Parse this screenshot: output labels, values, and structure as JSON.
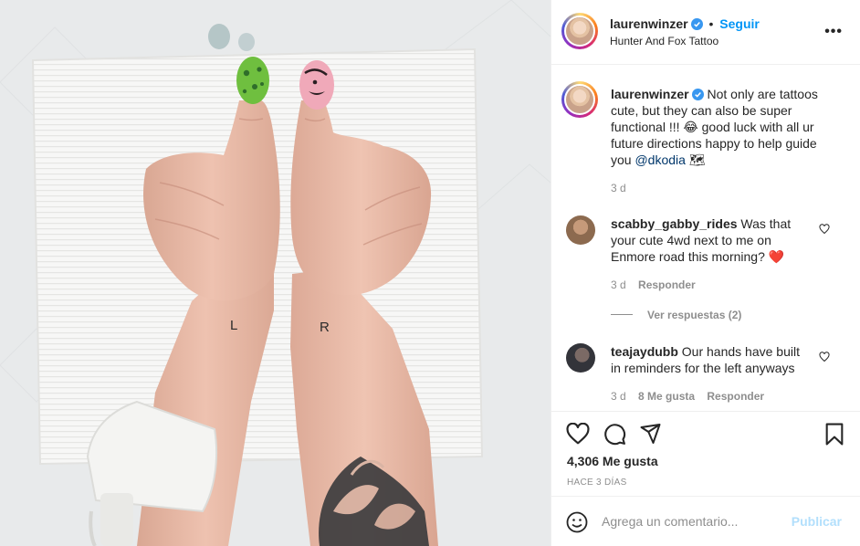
{
  "header": {
    "username": "laurenwinzer",
    "separator": "•",
    "follow_label": "Seguir",
    "location": "Hunter And Fox Tattoo",
    "more_icon": "more-horizontal-icon"
  },
  "caption": {
    "username": "laurenwinzer",
    "text_part1": "Not only are tattoos cute, but they can also be super functional !!! 😂 good luck with all ur future directions happy to help guide you ",
    "mention": "@dkodia",
    "text_part2": " 🗺",
    "time": "3 d"
  },
  "comments": [
    {
      "username": "scabby_gabby_rides",
      "text": "Was that your cute 4wd next to me on Enmore road this morning? ❤️",
      "time": "3 d",
      "reply_label": "Responder",
      "view_replies": "Ver respuestas (2)"
    },
    {
      "username": "teajaydubb",
      "text": "Our hands have built in reminders for the left anyways",
      "time": "3 d",
      "likes": "8 Me gusta",
      "reply_label": "Responder"
    }
  ],
  "actions": {
    "like_icon": "heart-icon",
    "comment_icon": "comment-icon",
    "share_icon": "share-icon",
    "save_icon": "bookmark-icon",
    "likes_text": "4,306 Me gusta",
    "posted_ago": "HACE 3 DÍAS"
  },
  "add_comment": {
    "emoji_icon": "emoji-icon",
    "placeholder": "Agrega un comentario...",
    "publish_label": "Publicar"
  },
  "photo": {
    "left_letter": "L",
    "right_letter": "R"
  },
  "colors": {
    "accent": "#0095f6",
    "publish_disabled": "#b2dffc",
    "verified": "#3897f0",
    "link": "#00376b",
    "heart_red": "#ed4956"
  }
}
